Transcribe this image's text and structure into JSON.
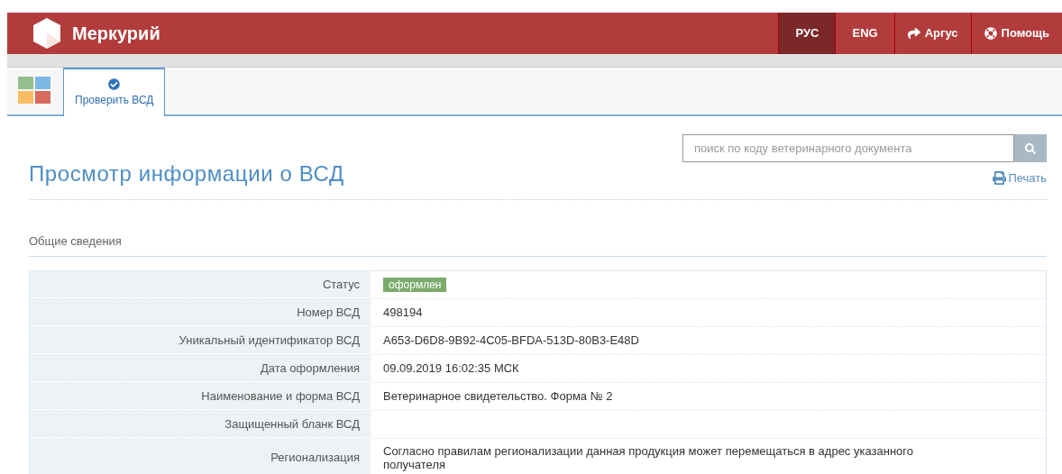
{
  "header": {
    "app_name": "Меркурий",
    "languages": [
      {
        "label": "РУС",
        "selected": true
      },
      {
        "label": "ENG",
        "selected": false
      }
    ],
    "links": [
      {
        "label": "Аргус",
        "kind": "share"
      },
      {
        "label": "Помощь",
        "kind": "help"
      }
    ]
  },
  "tabs": [
    {
      "label": "Проверить ВСД",
      "selected": true
    }
  ],
  "search": {
    "placeholder": "поиск по коду ветеринарного документа"
  },
  "print_link": "Печать",
  "page_title": "Просмотр информации о ВСД",
  "section_title": "Общие сведения",
  "rows": [
    {
      "label": "Статус",
      "kind": "badge",
      "value": "оформлен",
      "color": "#7aab6b"
    },
    {
      "label": "Номер ВСД",
      "kind": "text",
      "value": "498194"
    },
    {
      "label": "Уникальный идентификатор ВСД",
      "kind": "text",
      "value": "A653-D6D8-9B92-4C05-BFDA-513D-80B3-E48D"
    },
    {
      "label": "Дата оформления",
      "kind": "text",
      "value": "09.09.2019 16:02:35 МСК"
    },
    {
      "label": "Наименование и форма ВСД",
      "kind": "text",
      "value": "Ветеринарное свидетельство. Форма № 2"
    },
    {
      "label": "Защищенный бланк ВСД",
      "kind": "text"
    },
    {
      "label": "Регионализация",
      "kind": "text",
      "value": "Согласно правилам регионализации данная продукция может перемещаться в адрес указанного получателя"
    }
  ]
}
